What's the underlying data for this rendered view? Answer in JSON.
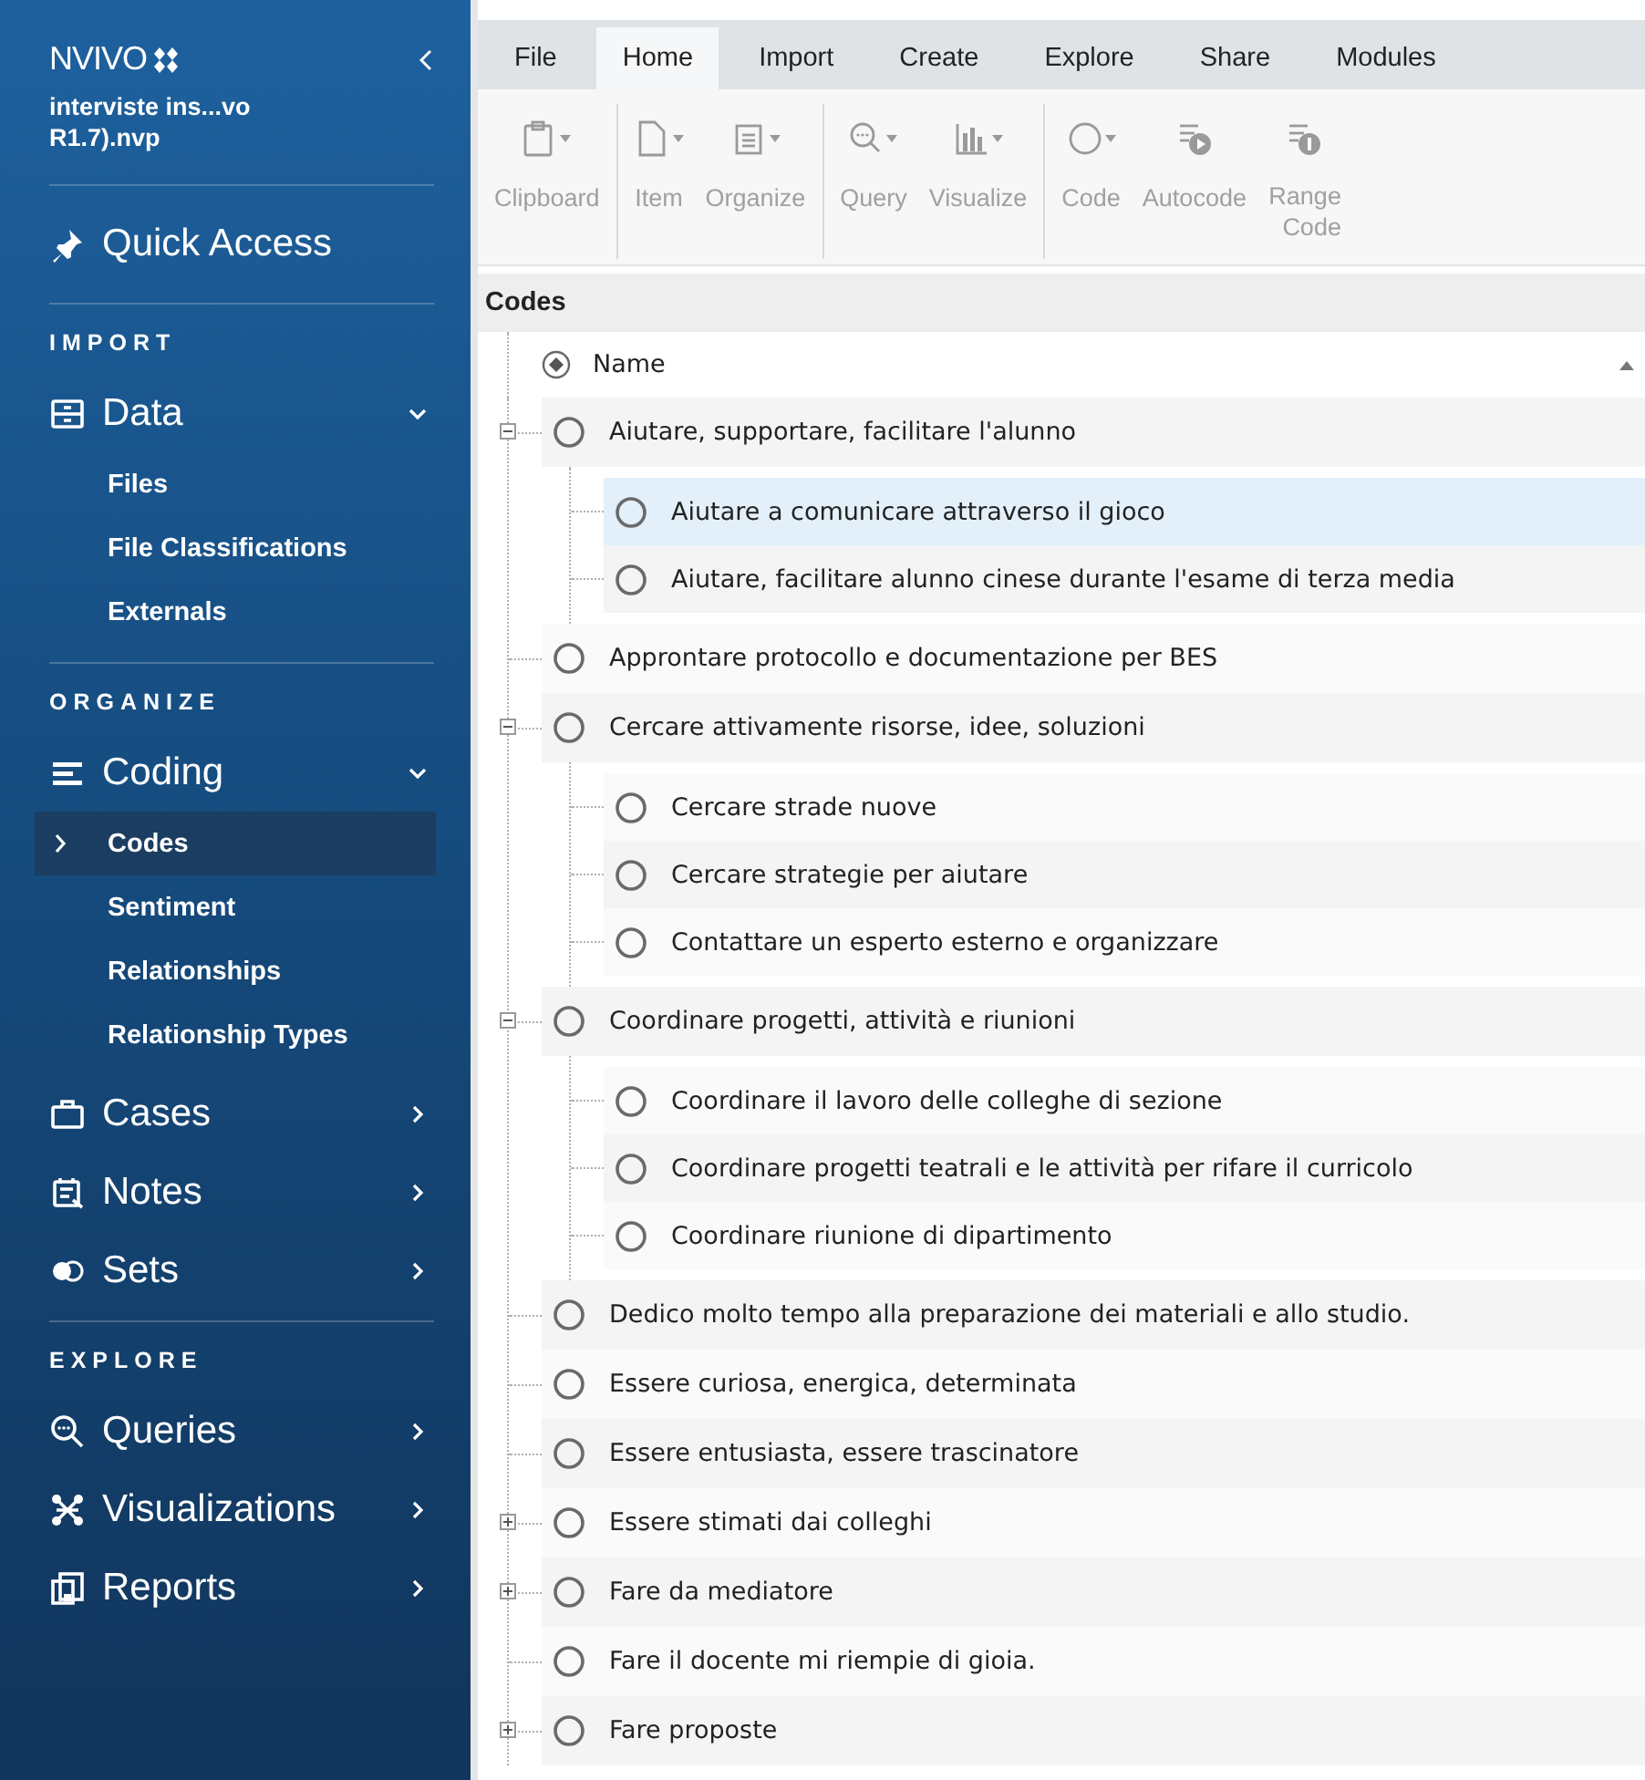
{
  "sidebar": {
    "logo": "NVIVO",
    "project_lines": [
      "interviste ins...vo",
      "R1.7).nvp"
    ],
    "sections": [
      {
        "kind": "link",
        "label": "Quick Access"
      },
      {
        "kind": "heading",
        "label": "IMPORT"
      },
      {
        "kind": "nav",
        "label": "Data",
        "expanded": true,
        "children": [
          {
            "label": "Files",
            "selected": false
          },
          {
            "label": "File Classifications",
            "selected": false
          },
          {
            "label": "Externals",
            "selected": false
          }
        ]
      },
      {
        "kind": "heading",
        "label": "ORGANIZE"
      },
      {
        "kind": "nav",
        "label": "Coding",
        "expanded": true,
        "children": [
          {
            "label": "Codes",
            "selected": true
          },
          {
            "label": "Sentiment",
            "selected": false
          },
          {
            "label": "Relationships",
            "selected": false
          },
          {
            "label": "Relationship Types",
            "selected": false
          }
        ]
      },
      {
        "kind": "nav",
        "label": "Cases",
        "expanded": false
      },
      {
        "kind": "nav",
        "label": "Notes",
        "expanded": false
      },
      {
        "kind": "nav",
        "label": "Sets",
        "expanded": false
      },
      {
        "kind": "heading",
        "label": "EXPLORE"
      },
      {
        "kind": "nav",
        "label": "Queries",
        "expanded": false
      },
      {
        "kind": "nav",
        "label": "Visualizations",
        "expanded": false
      },
      {
        "kind": "nav",
        "label": "Reports",
        "expanded": false
      }
    ]
  },
  "ribbon": {
    "tabs": [
      {
        "label": "File",
        "selected": false
      },
      {
        "label": "Home",
        "selected": true
      },
      {
        "label": "Import",
        "selected": false
      },
      {
        "label": "Create",
        "selected": false
      },
      {
        "label": "Explore",
        "selected": false
      },
      {
        "label": "Share",
        "selected": false
      },
      {
        "label": "Modules",
        "selected": false
      }
    ],
    "groups": [
      [
        {
          "label": "Clipboard",
          "dropdown": true,
          "disabled": true
        }
      ],
      [
        {
          "label": "Item",
          "dropdown": true,
          "disabled": true
        },
        {
          "label": "Organize",
          "dropdown": true,
          "disabled": true
        }
      ],
      [
        {
          "label": "Query",
          "dropdown": true,
          "disabled": true
        },
        {
          "label": "Visualize",
          "dropdown": true,
          "disabled": true
        }
      ],
      [
        {
          "label": "Code",
          "dropdown": true,
          "disabled": true
        },
        {
          "label": "Autocode",
          "dropdown": false,
          "disabled": true
        },
        {
          "label": "Range Code",
          "dropdown": false,
          "disabled": true
        }
      ]
    ]
  },
  "codes": {
    "title": "Codes",
    "column": "Name",
    "sorted_ascending": true,
    "nodes": [
      {
        "name": "Aiutare, supportare, facilitare l'alunno",
        "selected": false,
        "expanded": true,
        "children": [
          {
            "name": "Aiutare a comunicare  attraverso il gioco",
            "selected": true
          },
          {
            "name": "Aiutare, facilitare alunno cinese durante l'esame di terza media",
            "selected": false
          }
        ]
      },
      {
        "name": "Approntare protocollo e documentazione per BES",
        "selected": false
      },
      {
        "name": "Cercare attivamente risorse, idee, soluzioni",
        "selected": false,
        "expanded": true,
        "children": [
          {
            "name": "Cercare strade nuove",
            "selected": false
          },
          {
            "name": "Cercare strategie per aiutare",
            "selected": false
          },
          {
            "name": "Contattare un esperto esterno e organizzare",
            "selected": false
          }
        ]
      },
      {
        "name": "Coordinare progetti, attività e riunioni",
        "selected": false,
        "expanded": true,
        "children": [
          {
            "name": "Coordinare il lavoro delle colleghe di sezione",
            "selected": false
          },
          {
            "name": "Coordinare progetti teatrali e le attività per rifare il curricolo",
            "selected": false
          },
          {
            "name": "Coordinare riunione di dipartimento",
            "selected": false
          }
        ]
      },
      {
        "name": "Dedico molto tempo alla preparazione dei materiali e allo studio.",
        "selected": false
      },
      {
        "name": "Essere curiosa, energica, determinata",
        "selected": false
      },
      {
        "name": "Essere entusiasta, essere trascinatore",
        "selected": false
      },
      {
        "name": "Essere stimati dai colleghi",
        "selected": false,
        "expanded": false
      },
      {
        "name": "Fare da mediatore",
        "selected": false,
        "expanded": false
      },
      {
        "name": "Fare il docente mi riempie di gioia.",
        "selected": false
      },
      {
        "name": "Fare proposte",
        "selected": false,
        "expanded": false
      }
    ]
  }
}
